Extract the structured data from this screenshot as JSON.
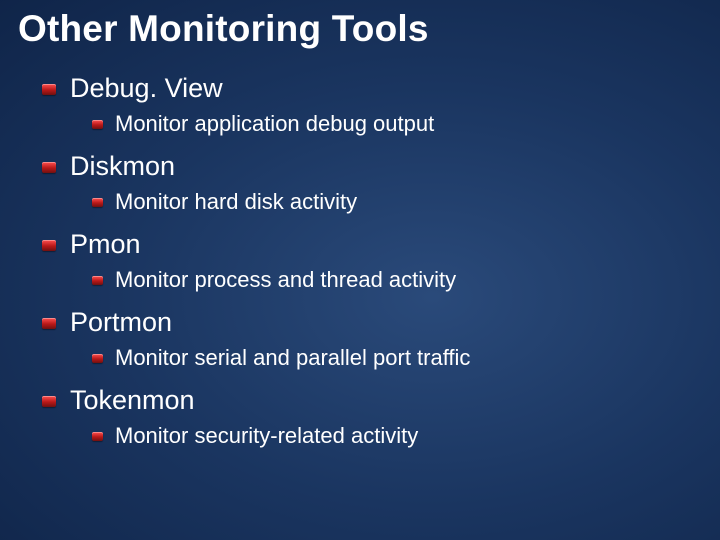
{
  "title": "Other Monitoring Tools",
  "items": [
    {
      "name": "Debug. View",
      "desc": "Monitor application debug output"
    },
    {
      "name": "Diskmon",
      "desc": "Monitor hard disk activity"
    },
    {
      "name": "Pmon",
      "desc": "Monitor process and thread activity"
    },
    {
      "name": "Portmon",
      "desc": "Monitor serial and parallel port traffic"
    },
    {
      "name": "Tokenmon",
      "desc": "Monitor security-related activity"
    }
  ]
}
